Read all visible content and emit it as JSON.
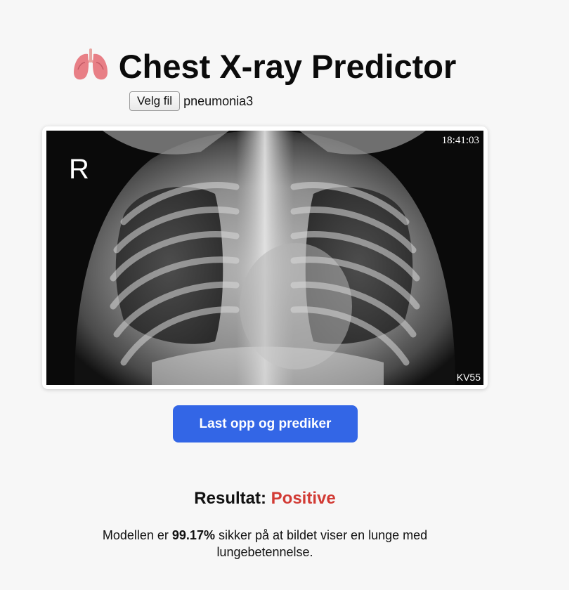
{
  "header": {
    "title": "Chest X-ray Predictor",
    "icon": "lungs-icon"
  },
  "upload": {
    "choose_file_label": "Velg fil",
    "file_name": "pneumonia3"
  },
  "xray": {
    "side_marker": "R",
    "timestamp": "18:41:03",
    "corner_code": "KV55"
  },
  "actions": {
    "predict_label": "Last opp og prediker"
  },
  "result": {
    "label": "Resultat:",
    "value": "Positive",
    "value_color": "#d23b35",
    "description_prefix": "Modellen er",
    "confidence": "99.17%",
    "description_suffix": "sikker på at bildet viser en lunge med lungebetennelse."
  },
  "colors": {
    "accent": "#3366e6",
    "background": "#f7f7f7"
  }
}
